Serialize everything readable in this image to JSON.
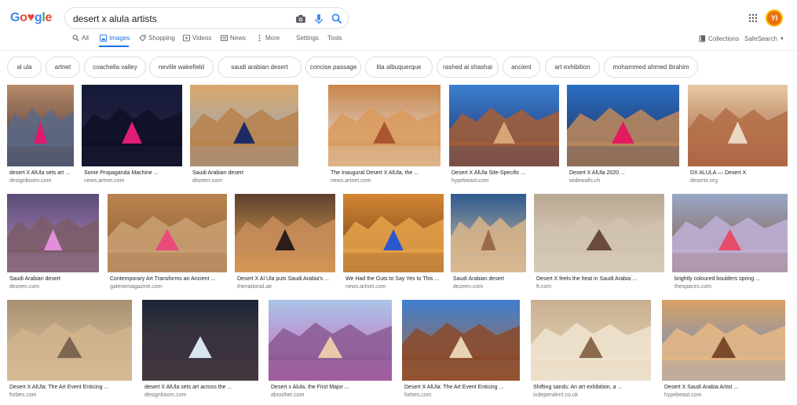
{
  "search": {
    "query": "desert x alula artists"
  },
  "logo": {
    "text": "Google"
  },
  "tabs": [
    {
      "label": "All"
    },
    {
      "label": "Images"
    },
    {
      "label": "Shopping"
    },
    {
      "label": "Videos"
    },
    {
      "label": "News"
    },
    {
      "label": "More"
    },
    {
      "label": "Settings"
    },
    {
      "label": "Tools"
    }
  ],
  "right": {
    "collections": "Collections",
    "safesearch": "SafeSearch"
  },
  "avatar": {
    "initials": "YI",
    "color": "#e8710a"
  },
  "chips": [
    "al ula",
    "artnet",
    "coachella valley",
    "neville wakefield",
    "saudi arabian desert",
    "concise passage",
    "lita albuquerque",
    "rashed al shashai",
    "ancient",
    "art exhibition",
    "mohammed ahmed ibrahim"
  ],
  "results": [
    {
      "title": "desert X AlUla sets art ...",
      "source": "designboom.com",
      "palette": [
        "#b88a68",
        "#3b2a33",
        "#e0186e",
        "#5a6a88"
      ]
    },
    {
      "title": "Some Propaganda Machine ...",
      "source": "news.artnet.com",
      "palette": [
        "#151a38",
        "#2b2345",
        "#e01d78",
        "#0d1024"
      ]
    },
    {
      "title": "Saudi Arabian desert",
      "source": "dezeen.com",
      "palette": [
        "#d9a86b",
        "#8ba7c8",
        "#1e2a64",
        "#b8814a"
      ]
    },
    {
      "title": "The Inaugural Desert X AlUla, the ...",
      "source": "news.artnet.com",
      "palette": [
        "#c9844a",
        "#e7eef2",
        "#a9552e",
        "#d99a5c"
      ]
    },
    {
      "title": "Desert X AlUla Site-Specific ...",
      "source": "hypebeast.com",
      "palette": [
        "#3d7fcf",
        "#1a2e6a",
        "#d7a478",
        "#a65e36"
      ]
    },
    {
      "title": "Desert X AlUla 2020 ...",
      "source": "widewalls.ch",
      "palette": [
        "#2b6ec4",
        "#1e2a4f",
        "#e41a60",
        "#c08a5a"
      ]
    },
    {
      "title": "DX ALULA — Desert X",
      "source": "desertx.org",
      "palette": [
        "#e8c9a4",
        "#9a5434",
        "#e9d8c2",
        "#b36e48"
      ]
    },
    {
      "title": "Saudi Arabian desert",
      "source": "dezeen.com",
      "palette": [
        "#5a4c78",
        "#b88cc0",
        "#e28fd9",
        "#7a5c66"
      ]
    },
    {
      "title": "Contemporary Art Transforms an Ancient ...",
      "source": "galeriemagazine.com",
      "palette": [
        "#b8844e",
        "#8e5b34",
        "#e84a7a",
        "#c9a073"
      ]
    },
    {
      "title": "Desert X Al Ula puts Saudi Arabia's ...",
      "source": "thenational.ae",
      "palette": [
        "#5e3f30",
        "#f0b050",
        "#2c1d18",
        "#c88c5a"
      ]
    },
    {
      "title": "We Had the Guts to Say Yes to This ...",
      "source": "news.artnet.com",
      "palette": [
        "#d48632",
        "#6b3a18",
        "#2a58d0",
        "#e5a24a"
      ]
    },
    {
      "title": "Saudi Arabian desert",
      "source": "dezeen.com",
      "palette": [
        "#2f5a8e",
        "#e2c8a2",
        "#9a6a4a",
        "#d8b48a"
      ]
    },
    {
      "title": "Desert X feels the heat in Saudi Arabia ...",
      "source": "ft.com",
      "palette": [
        "#b9a892",
        "#e8dccb",
        "#6a4a3a",
        "#cfc2ae"
      ]
    },
    {
      "title": "brightly coloured boulders spring ...",
      "source": "thespaces.com",
      "palette": [
        "#98a6c6",
        "#8a5a3e",
        "#e74c6a",
        "#c0b0d8"
      ]
    },
    {
      "title": "Desert X AlUla: The Art Event Enticing ...",
      "source": "forbes.com",
      "palette": [
        "#a89070",
        "#e2cba8",
        "#7c6650",
        "#d1b48c"
      ]
    },
    {
      "title": "desert X AlUla sets art across the ...",
      "source": "designboom.com",
      "palette": [
        "#1c2538",
        "#5b4a3c",
        "#d9e4f2",
        "#3a3040"
      ]
    },
    {
      "title": "Desert x Alula, the First Major ...",
      "source": "abouther.com",
      "palette": [
        "#a8c6e8",
        "#d35fb8",
        "#e8c8a8",
        "#8a5a94"
      ]
    },
    {
      "title": "Desert X AlUla: The Art Event Enticing ...",
      "source": "forbes.com",
      "palette": [
        "#3f7fd0",
        "#b0683a",
        "#e7d3b4",
        "#8a4a2a"
      ]
    },
    {
      "title": "Shifting sands: An art exhibition, a ...",
      "source": "independent.co.uk",
      "palette": [
        "#c9b090",
        "#e6d6bc",
        "#8a6a4a",
        "#f0e4d0"
      ]
    },
    {
      "title": "Desert X Saudi Arabia Artist ...",
      "source": "hypebeast.com",
      "palette": [
        "#d9a064",
        "#5a8fd6",
        "#7a4a2a",
        "#e8b884"
      ]
    }
  ]
}
